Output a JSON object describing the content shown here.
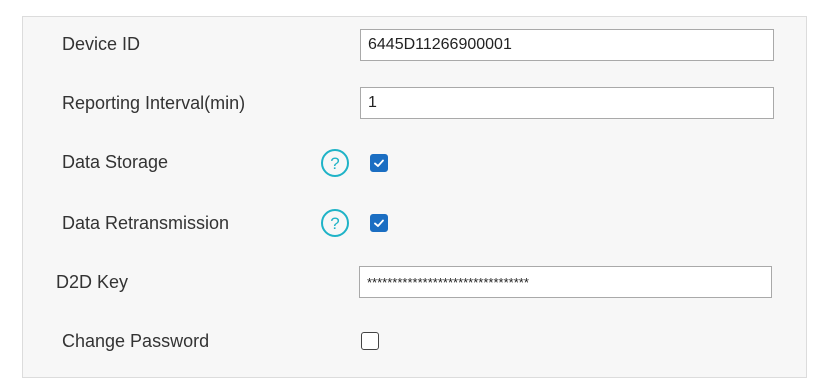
{
  "form": {
    "device_id": {
      "label": "Device ID",
      "value": "6445D11266900001"
    },
    "reporting_interval": {
      "label": "Reporting Interval(min)",
      "value": "1"
    },
    "data_storage": {
      "label": "Data Storage",
      "help_icon": "question-circle-icon",
      "checked": true
    },
    "data_retransmission": {
      "label": "Data Retransmission",
      "help_icon": "question-circle-icon",
      "checked": true
    },
    "d2d_key": {
      "label": "D2D Key",
      "value": "********************************"
    },
    "change_password": {
      "label": "Change Password",
      "checked": false
    }
  },
  "colors": {
    "panel_background": "#f7f7f7",
    "help_icon": "#1fb3c7",
    "checkbox_checked": "#1b6ec2"
  }
}
